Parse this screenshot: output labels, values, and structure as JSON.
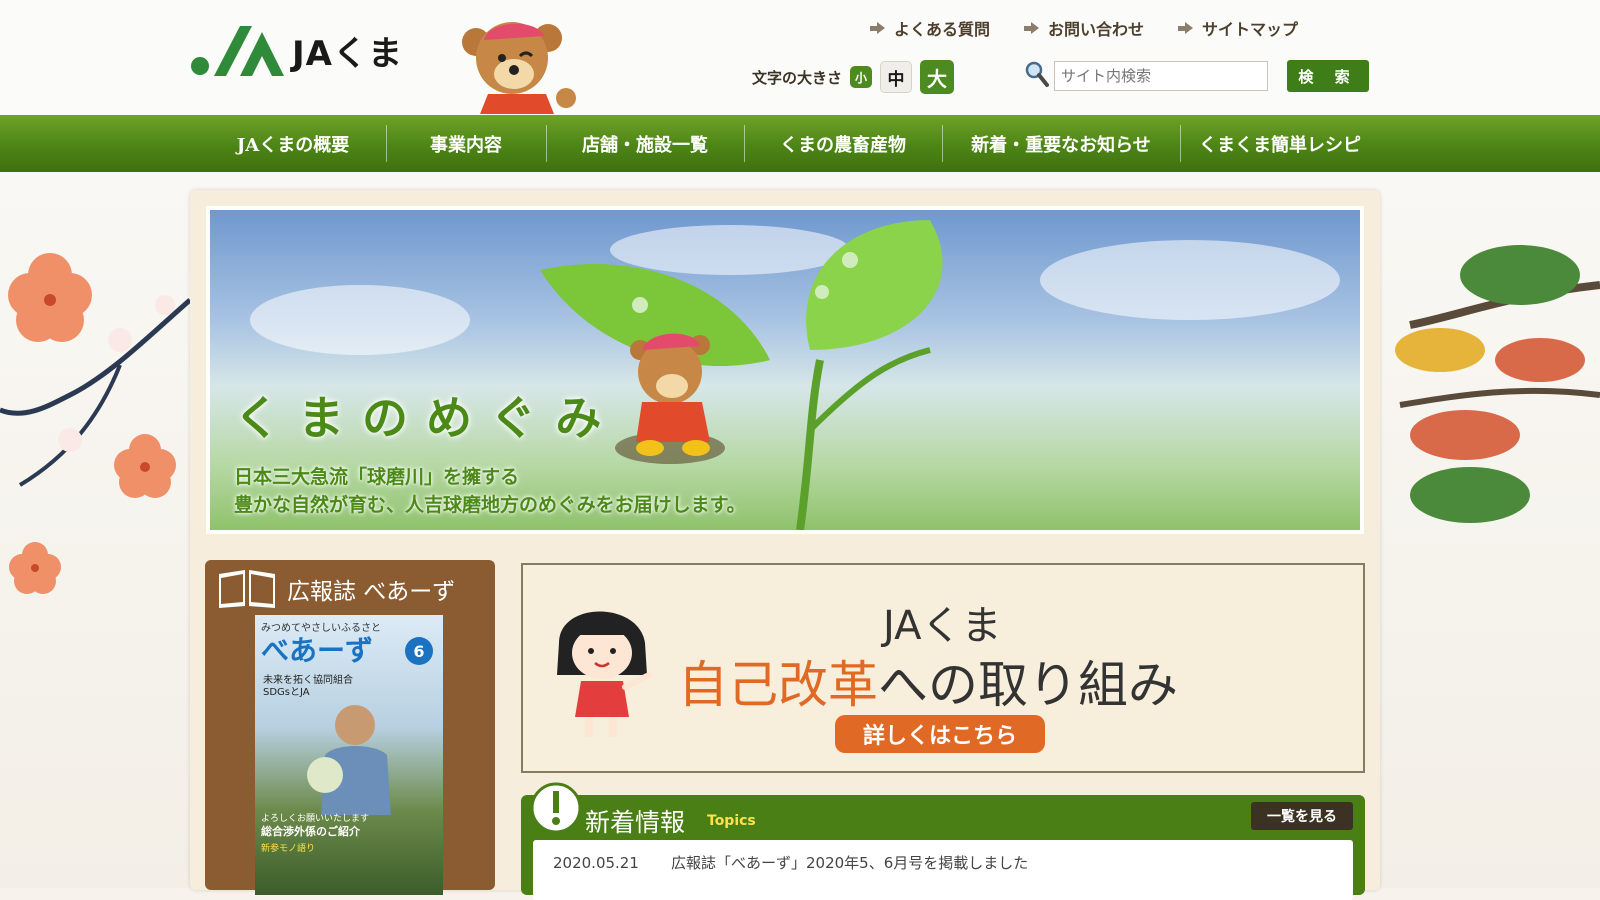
{
  "header": {
    "logo_text": "JAくま",
    "top_links": [
      "よくある質問",
      "お問い合わせ",
      "サイトマップ"
    ],
    "font_size_label": "文字の大きさ",
    "font_sizes": {
      "small": "小",
      "medium": "中",
      "large": "大"
    },
    "search_placeholder": "サイト内検索",
    "search_button": "検 索"
  },
  "nav": {
    "items": [
      "JAくまの概要",
      "事業内容",
      "店舗・施設一覧",
      "くまの農畜産物",
      "新着・重要なお知らせ",
      "くまくま簡単レシピ"
    ]
  },
  "hero": {
    "title": "くまのめぐみ",
    "line1": "日本三大急流「球磨川」を擁する",
    "line2": "豊かな自然が育む、人吉球磨地方のめぐみをお届けします。"
  },
  "magazine": {
    "heading": "広報誌 べあーず",
    "cover_top": "みつめてやさしいふるさと",
    "cover_name": "べあーず",
    "cover_issue": "6",
    "cover_sub1": "未来を拓く協同組合",
    "cover_sub2": "SDGsとJA",
    "cover_bottom1": "よろしくお願いいたします",
    "cover_bottom2": "総合渉外係のご紹介",
    "cover_bottom3": "新参モノ語り"
  },
  "reform": {
    "org": "JAくま",
    "title_accent": "自己改革",
    "title_rest": "への取り組み",
    "button": "詳しくはこちら"
  },
  "topics": {
    "title": "新着情報",
    "subtitle": "Topics",
    "more": "一覧を見る",
    "items": [
      {
        "date": "2020.05.21",
        "text": "広報誌「べあーず」2020年5、6月号を掲載しました"
      }
    ]
  },
  "colors": {
    "brand_green": "#4c8516",
    "accent_orange": "#e06a25",
    "frame_beige": "#f6eddc"
  }
}
